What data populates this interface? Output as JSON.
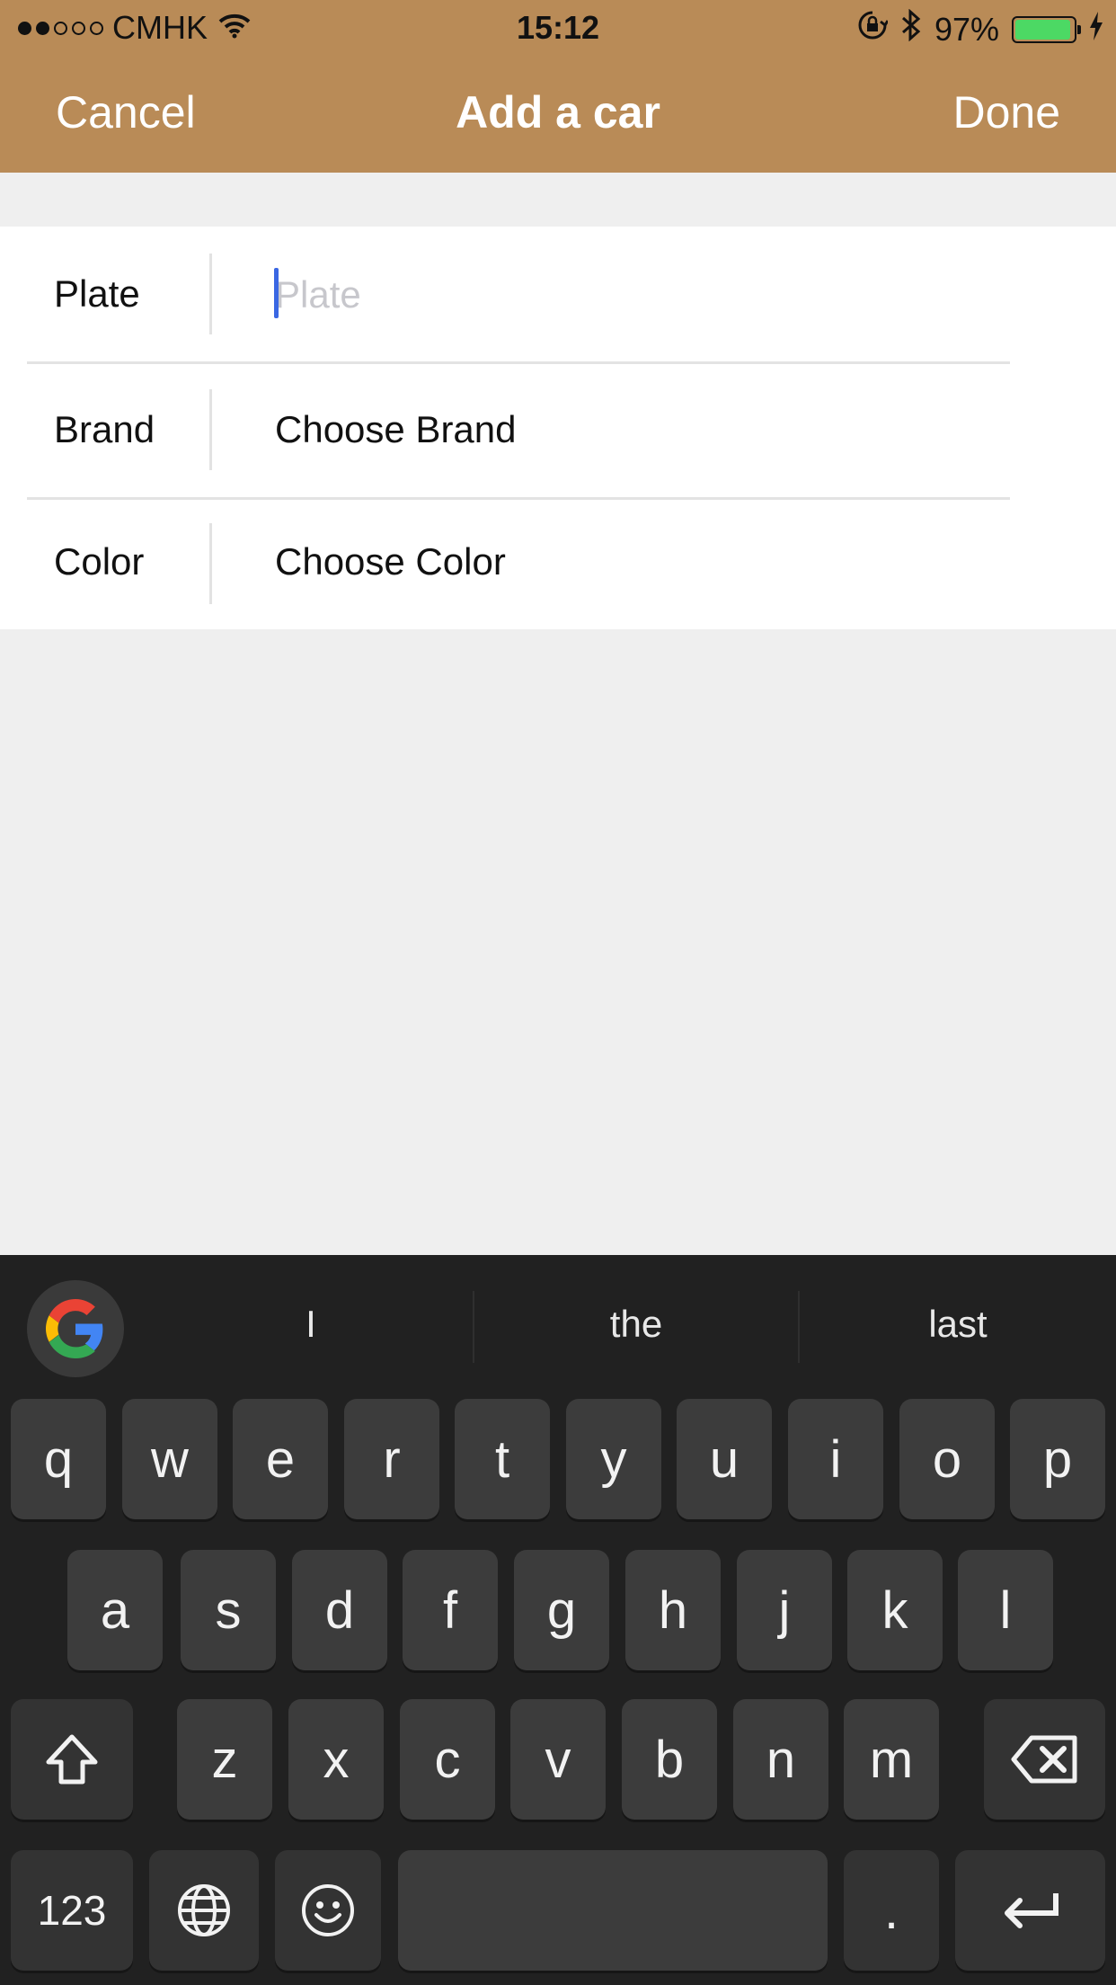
{
  "status_bar": {
    "carrier": "CMHK",
    "time": "15:12",
    "battery": "97%",
    "icons": [
      "wifi-icon",
      "orientation-lock-icon",
      "bluetooth-icon",
      "battery-icon",
      "charging-icon"
    ]
  },
  "nav": {
    "cancel": "Cancel",
    "title": "Add a car",
    "done": "Done"
  },
  "form": {
    "plate": {
      "label": "Plate",
      "placeholder": "Plate",
      "value": ""
    },
    "brand": {
      "label": "Brand",
      "value": "Choose Brand"
    },
    "color": {
      "label": "Color",
      "value": "Choose Color"
    }
  },
  "keyboard": {
    "suggestions": [
      "I",
      "the",
      "last"
    ],
    "row1": [
      "q",
      "w",
      "e",
      "r",
      "t",
      "y",
      "u",
      "i",
      "o",
      "p"
    ],
    "row2": [
      "a",
      "s",
      "d",
      "f",
      "g",
      "h",
      "j",
      "k",
      "l"
    ],
    "row3": [
      "z",
      "x",
      "c",
      "v",
      "b",
      "n",
      "m"
    ],
    "numbers_key": "123",
    "period_key": "."
  },
  "colors": {
    "nav_background": "#b98b57",
    "page_background": "#efefef",
    "keyboard_background": "#212121",
    "key_background": "#3c3c3c",
    "caret": "#3a67e3"
  }
}
